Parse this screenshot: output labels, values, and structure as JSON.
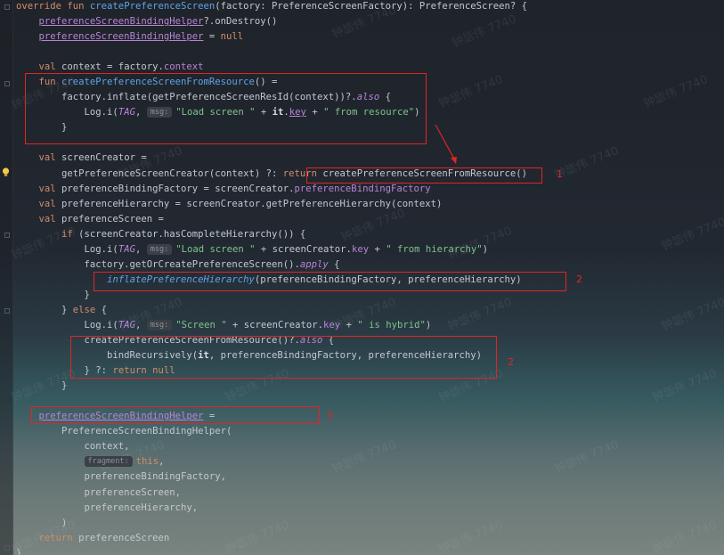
{
  "editor": {
    "lines": [
      [
        {
          "t": "override ",
          "c": "kw"
        },
        {
          "t": "fun ",
          "c": "kw"
        },
        {
          "t": "createPreferenceScreen",
          "c": "fn"
        },
        {
          "t": "(factory: PreferenceScreenFactory): PreferenceScreen? {",
          "c": ""
        }
      ],
      [
        {
          "t": "    ",
          "c": ""
        },
        {
          "t": "preferenceScreenBindingHelper",
          "c": "prop ul"
        },
        {
          "t": "?.onDestroy()",
          "c": ""
        }
      ],
      [
        {
          "t": "    ",
          "c": ""
        },
        {
          "t": "preferenceScreenBindingHelper",
          "c": "prop ul"
        },
        {
          "t": " = ",
          "c": ""
        },
        {
          "t": "null",
          "c": "kw"
        }
      ],
      [],
      [
        {
          "t": "    ",
          "c": ""
        },
        {
          "t": "val ",
          "c": "kw"
        },
        {
          "t": "context = factory.",
          "c": ""
        },
        {
          "t": "context",
          "c": "prop"
        }
      ],
      [
        {
          "t": "    ",
          "c": ""
        },
        {
          "t": "fun ",
          "c": "kw"
        },
        {
          "t": "createPreferenceScreenFromResource",
          "c": "fn"
        },
        {
          "t": "() =",
          "c": ""
        }
      ],
      [
        {
          "t": "        factory.inflate(getPreferenceScreenResId(context))?.",
          "c": ""
        },
        {
          "t": "also",
          "c": "prop it"
        },
        {
          "t": " {",
          "c": ""
        }
      ],
      [
        {
          "t": "            Log.i(",
          "c": ""
        },
        {
          "t": "TAG",
          "c": "prop it"
        },
        {
          "t": ", ",
          "c": ""
        },
        {
          "hint": "msg:"
        },
        {
          "t": "\"Load screen \"",
          "c": "str"
        },
        {
          "t": " + ",
          "c": ""
        },
        {
          "t": "it",
          "c": "bold"
        },
        {
          "t": ".",
          "c": ""
        },
        {
          "t": "key",
          "c": "prop ul"
        },
        {
          "t": " + ",
          "c": ""
        },
        {
          "t": "\" from resource\"",
          "c": "str"
        },
        {
          "t": ")",
          "c": ""
        }
      ],
      [
        {
          "t": "        }",
          "c": ""
        }
      ],
      [],
      [
        {
          "t": "    ",
          "c": ""
        },
        {
          "t": "val ",
          "c": "kw"
        },
        {
          "t": "screenCreator =",
          "c": ""
        }
      ],
      [
        {
          "t": "        getPreferenceScreenCreator(context) ?: ",
          "c": ""
        },
        {
          "t": "return ",
          "c": "kw"
        },
        {
          "t": "createPreferenceScreenFromResource()",
          "c": ""
        }
      ],
      [
        {
          "t": "    ",
          "c": ""
        },
        {
          "t": "val ",
          "c": "kw"
        },
        {
          "t": "preferenceBindingFactory = screenCreator.",
          "c": ""
        },
        {
          "t": "preferenceBindingFactory",
          "c": "prop"
        }
      ],
      [
        {
          "t": "    ",
          "c": ""
        },
        {
          "t": "val ",
          "c": "kw"
        },
        {
          "t": "preferenceHierarchy = screenCreator.getPreferenceHierarchy(context)",
          "c": ""
        }
      ],
      [
        {
          "t": "    ",
          "c": ""
        },
        {
          "t": "val ",
          "c": "kw"
        },
        {
          "t": "preferenceScreen =",
          "c": ""
        }
      ],
      [
        {
          "t": "        ",
          "c": ""
        },
        {
          "t": "if ",
          "c": "kw"
        },
        {
          "t": "(screenCreator.hasCompleteHierarchy()) {",
          "c": ""
        }
      ],
      [
        {
          "t": "            Log.i(",
          "c": ""
        },
        {
          "t": "TAG",
          "c": "prop it"
        },
        {
          "t": ", ",
          "c": ""
        },
        {
          "hint": "msg:"
        },
        {
          "t": "\"Load screen \"",
          "c": "str"
        },
        {
          "t": " + screenCreator.",
          "c": ""
        },
        {
          "t": "key",
          "c": "prop"
        },
        {
          "t": " + ",
          "c": ""
        },
        {
          "t": "\" from hierarchy\"",
          "c": "str"
        },
        {
          "t": ")",
          "c": ""
        }
      ],
      [
        {
          "t": "            factory.getOrCreatePreferenceScreen().",
          "c": ""
        },
        {
          "t": "apply",
          "c": "prop it"
        },
        {
          "t": " {",
          "c": ""
        }
      ],
      [
        {
          "t": "                ",
          "c": ""
        },
        {
          "t": "inflatePreferenceHierarchy",
          "c": "fn it"
        },
        {
          "t": "(preferenceBindingFactory, preferenceHierarchy)",
          "c": ""
        }
      ],
      [
        {
          "t": "            }",
          "c": ""
        }
      ],
      [
        {
          "t": "        } ",
          "c": ""
        },
        {
          "t": "else",
          "c": "kw"
        },
        {
          "t": " {",
          "c": ""
        }
      ],
      [
        {
          "t": "            Log.i(",
          "c": ""
        },
        {
          "t": "TAG",
          "c": "prop it"
        },
        {
          "t": ", ",
          "c": ""
        },
        {
          "hint": "msg:"
        },
        {
          "t": "\"Screen \"",
          "c": "str"
        },
        {
          "t": " + screenCreator.",
          "c": ""
        },
        {
          "t": "key",
          "c": "prop"
        },
        {
          "t": " + ",
          "c": ""
        },
        {
          "t": "\" is hybrid\"",
          "c": "str"
        },
        {
          "t": ")",
          "c": ""
        }
      ],
      [
        {
          "t": "            createPreferenceScreenFromResource()?.",
          "c": ""
        },
        {
          "t": "also",
          "c": "prop it"
        },
        {
          "t": " {",
          "c": ""
        }
      ],
      [
        {
          "t": "                bindRecursively(",
          "c": ""
        },
        {
          "t": "it",
          "c": "bold"
        },
        {
          "t": ", preferenceBindingFactory, preferenceHierarchy)",
          "c": ""
        }
      ],
      [
        {
          "t": "            } ?: ",
          "c": ""
        },
        {
          "t": "return ",
          "c": "kw"
        },
        {
          "t": "null",
          "c": "kw"
        }
      ],
      [
        {
          "t": "        }",
          "c": ""
        }
      ],
      [],
      [
        {
          "t": "    ",
          "c": ""
        },
        {
          "t": "preferenceScreenBindingHelper",
          "c": "prop ul"
        },
        {
          "t": " =",
          "c": ""
        }
      ],
      [
        {
          "t": "        PreferenceScreenBindingHelper(",
          "c": ""
        }
      ],
      [
        {
          "t": "            context,",
          "c": ""
        }
      ],
      [
        {
          "t": "            ",
          "c": ""
        },
        {
          "hint": "fragment:"
        },
        {
          "t": "this",
          "c": "kw"
        },
        {
          "t": ",",
          "c": ""
        }
      ],
      [
        {
          "t": "            preferenceBindingFactory,",
          "c": ""
        }
      ],
      [
        {
          "t": "            preferenceScreen,",
          "c": ""
        }
      ],
      [
        {
          "t": "            preferenceHierarchy,",
          "c": ""
        }
      ],
      [
        {
          "t": "        )",
          "c": ""
        }
      ],
      [
        {
          "t": "    ",
          "c": ""
        },
        {
          "t": "return ",
          "c": "kw"
        },
        {
          "t": "preferenceScreen",
          "c": ""
        }
      ],
      [
        {
          "t": "}",
          "c": ""
        }
      ]
    ]
  },
  "annotations": {
    "label1": "1",
    "label2a": "2",
    "label2b": "2",
    "label3": "3"
  },
  "watermark": "钟毖伟 7740",
  "colors": {
    "annotation": "#e02525",
    "keyword": "#d08d6a",
    "function": "#5fa3e8",
    "property": "#b784d6",
    "string": "#7bc48a"
  },
  "icons": [
    "lightbulb-icon"
  ]
}
